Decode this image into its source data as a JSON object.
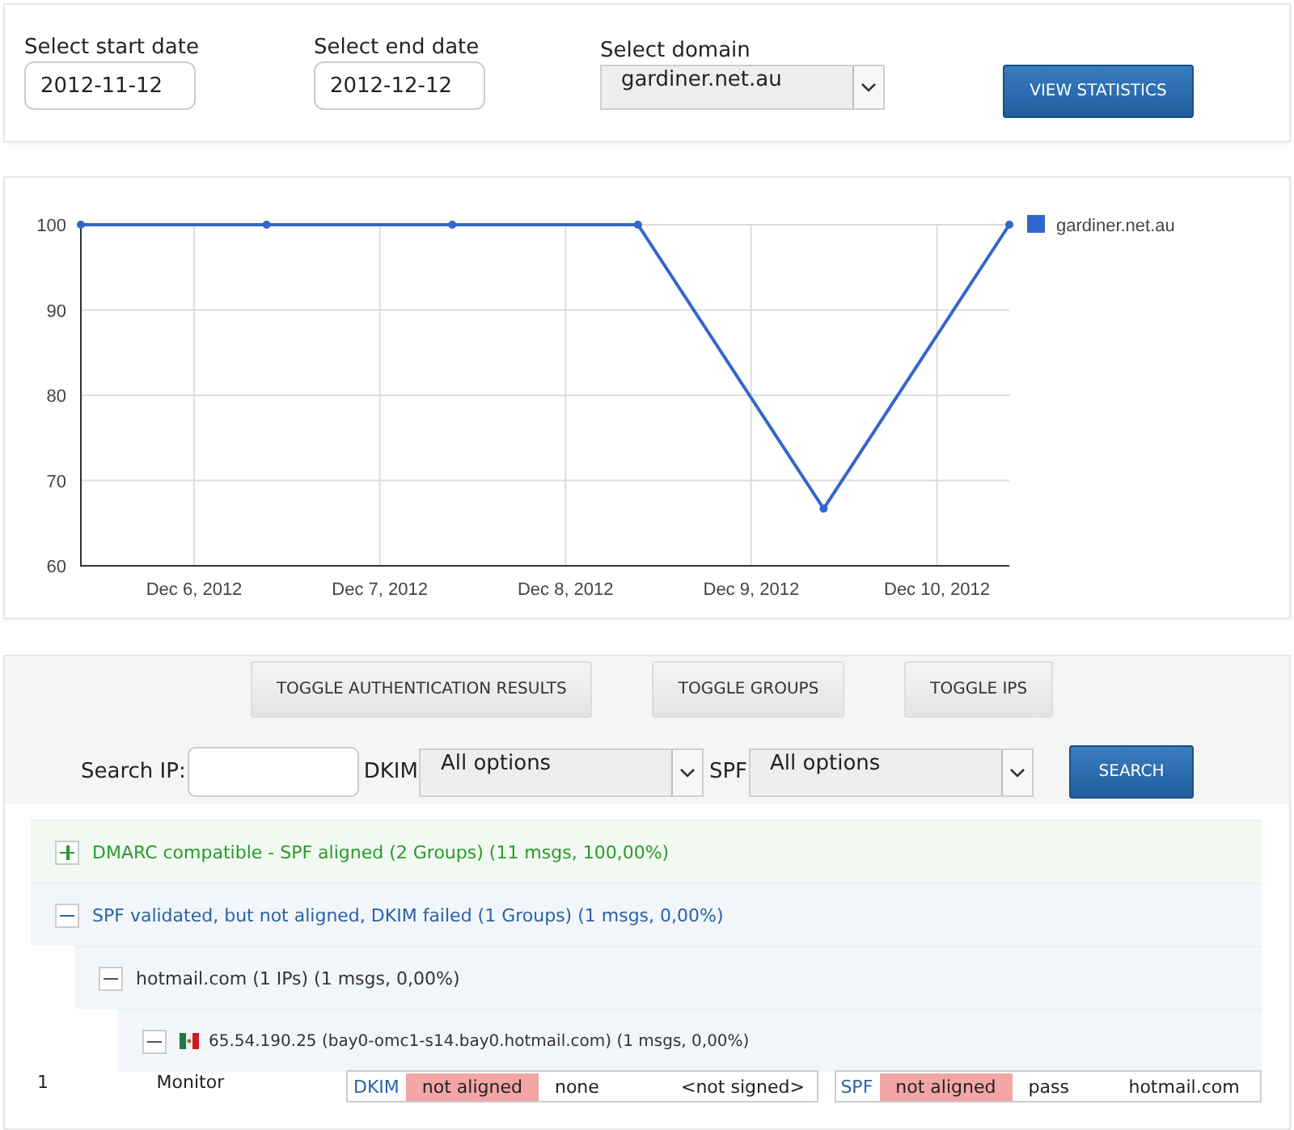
{
  "filters": {
    "start_date": {
      "label": "Select start date",
      "value": "2012-11-12"
    },
    "end_date": {
      "label": "Select end date",
      "value": "2012-12-12"
    },
    "domain": {
      "label": "Select domain",
      "value": "gardiner.net.au"
    },
    "button": "VIEW STATISTICS"
  },
  "chart": {
    "x_axis_labels": [
      "Dec 6, 2012",
      "Dec 7, 2012",
      "Dec 8, 2012",
      "Dec 9, 2012",
      "Dec 10, 2012"
    ],
    "chart_data": {
      "type": "line",
      "grid": true,
      "categories": [
        null,
        null,
        null,
        null,
        null,
        null
      ],
      "ylim": [
        60,
        100
      ],
      "yticks": [
        60,
        70,
        80,
        90,
        100
      ],
      "series": [
        {
          "name": "gardiner.net.au",
          "color": "#3366cc",
          "marker": true,
          "values": [
            100,
            100,
            100,
            100,
            66.7,
            100
          ]
        }
      ]
    }
  },
  "toolbar": {
    "toggles": [
      "TOGGLE AUTHENTICATION RESULTS",
      "TOGGLE GROUPS",
      "TOGGLE IPS"
    ],
    "search_label": "Search IP:",
    "dkim": {
      "label": "DKIM",
      "value": "All options"
    },
    "spf": {
      "label": "SPF",
      "value": "All options"
    },
    "search_button": "SEARCH"
  },
  "groups": [
    {
      "kind": "group",
      "label": "DMARC compatible - SPF aligned (2 Groups) (11 msgs, 100,00%)",
      "color": "#2a9a2a",
      "expanded": false
    },
    {
      "kind": "group",
      "label": "SPF validated, but not aligned, DKIM failed (1 Groups) (1 msgs, 0,00%)",
      "color": "#2a62a8",
      "expanded": true,
      "children": [
        {
          "kind": "domain",
          "label": "hotmail.com (1 IPs) (1 msgs, 0,00%)",
          "expanded": true,
          "children": [
            {
              "kind": "ip",
              "label": "65.54.190.25 (bay0-omc1-s14.bay0.hotmail.com) (1 msgs, 0,00%)",
              "expanded": true,
              "records": [
                {
                  "number": "1",
                  "policy": "Monitor",
                  "checks": [
                    {
                      "label": "DKIM",
                      "result": "not aligned",
                      "value": "none",
                      "domain": "<not signed>"
                    },
                    {
                      "label": "SPF",
                      "result": "not aligned",
                      "value": "pass",
                      "domain": "hotmail.com"
                    }
                  ]
                }
              ]
            }
          ]
        }
      ]
    }
  ]
}
